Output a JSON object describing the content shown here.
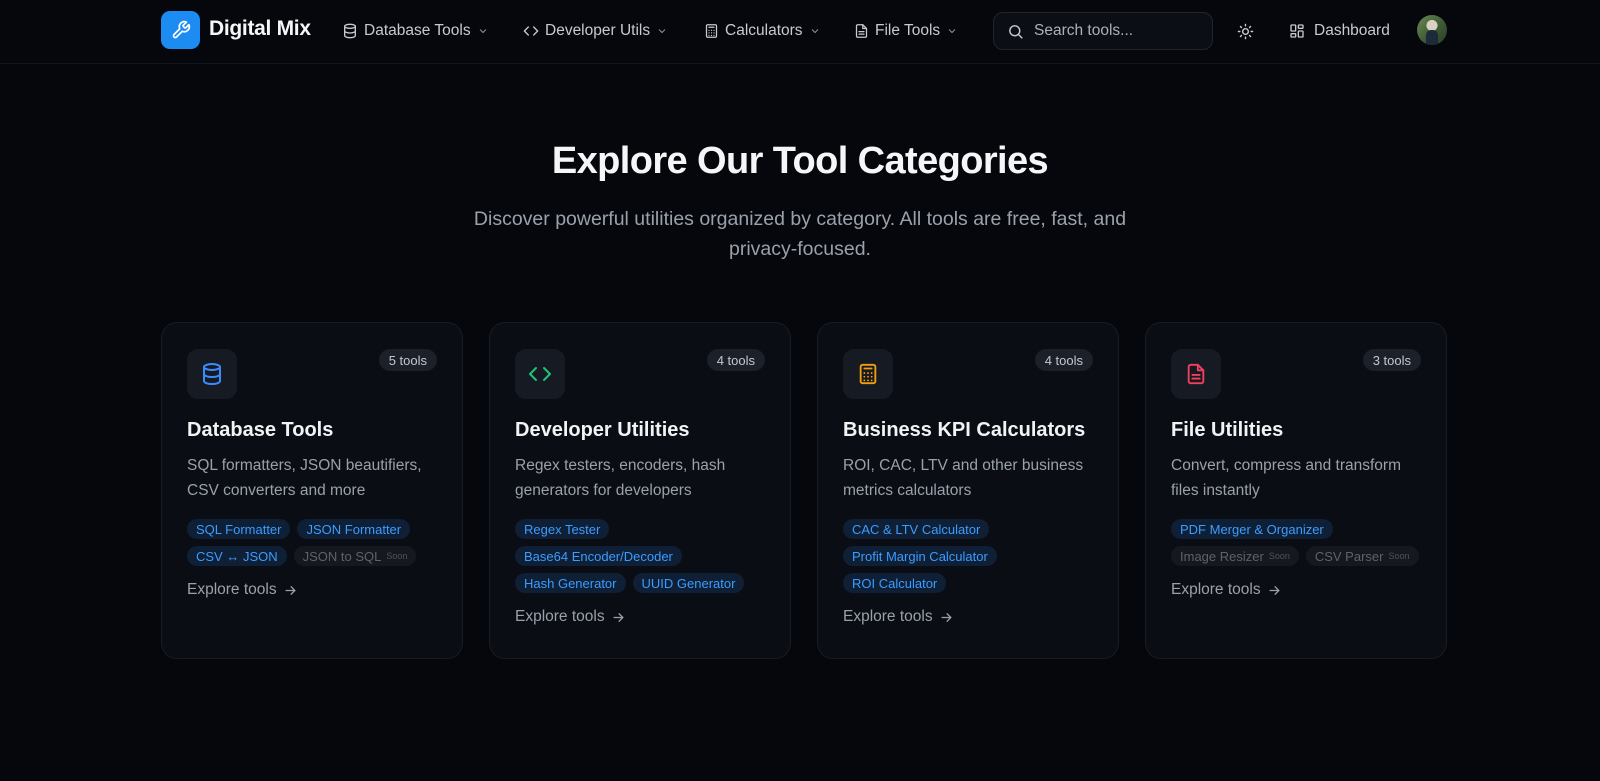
{
  "brand": {
    "name": "Digital Mix",
    "icon": "wrench-icon",
    "color": "#1d8cf2"
  },
  "nav": {
    "items": [
      {
        "label": "Database Tools",
        "icon": "database-icon"
      },
      {
        "label": "Developer Utils",
        "icon": "code-icon"
      },
      {
        "label": "Calculators",
        "icon": "calculator-icon"
      },
      {
        "label": "File Tools",
        "icon": "file-icon"
      }
    ],
    "search_placeholder": "Search tools...",
    "dashboard_label": "Dashboard"
  },
  "hero": {
    "title": "Explore Our Tool Categories",
    "subtitle_line1": "Discover powerful utilities organized by category. All tools are free, fast, and",
    "subtitle_line2": "privacy-focused."
  },
  "cards": [
    {
      "title": "Database Tools",
      "count": "5 tools",
      "icon": "database-icon",
      "icon_color": "#3b8bff",
      "desc": "SQL formatters, JSON beautifiers, CSV converters and more",
      "tags": [
        {
          "label": "SQL Formatter",
          "soon": false
        },
        {
          "label": "JSON Formatter",
          "soon": false
        },
        {
          "label": "CSV ↔ JSON",
          "soon": false
        },
        {
          "label": "JSON to SQL",
          "soon": true
        }
      ],
      "explore": "Explore tools"
    },
    {
      "title": "Developer Utilities",
      "count": "4 tools",
      "icon": "code-icon",
      "icon_color": "#22c27a",
      "desc": "Regex testers, encoders, hash generators for developers",
      "tags": [
        {
          "label": "Regex Tester",
          "soon": false
        },
        {
          "label": "Base64 Encoder/Decoder",
          "soon": false
        },
        {
          "label": "Hash Generator",
          "soon": false
        },
        {
          "label": "UUID Generator",
          "soon": false
        }
      ],
      "explore": "Explore tools"
    },
    {
      "title": "Business KPI Calculators",
      "count": "4 tools",
      "icon": "calculator-icon",
      "icon_color": "#f59e0b",
      "desc": "ROI, CAC, LTV and other business metrics calculators",
      "tags": [
        {
          "label": "CAC & LTV Calculator",
          "soon": false
        },
        {
          "label": "Profit Margin Calculator",
          "soon": false
        },
        {
          "label": "ROI Calculator",
          "soon": false
        }
      ],
      "explore": "Explore tools"
    },
    {
      "title": "File Utilities",
      "count": "3 tools",
      "icon": "file-icon",
      "icon_color": "#f43f5e",
      "desc": "Convert, compress and transform files instantly",
      "tags": [
        {
          "label": "PDF Merger & Organizer",
          "soon": false
        },
        {
          "label": "Image Resizer",
          "soon": true
        },
        {
          "label": "CSV Parser",
          "soon": true
        }
      ],
      "explore": "Explore tools"
    }
  ],
  "soon_label": "Soon"
}
